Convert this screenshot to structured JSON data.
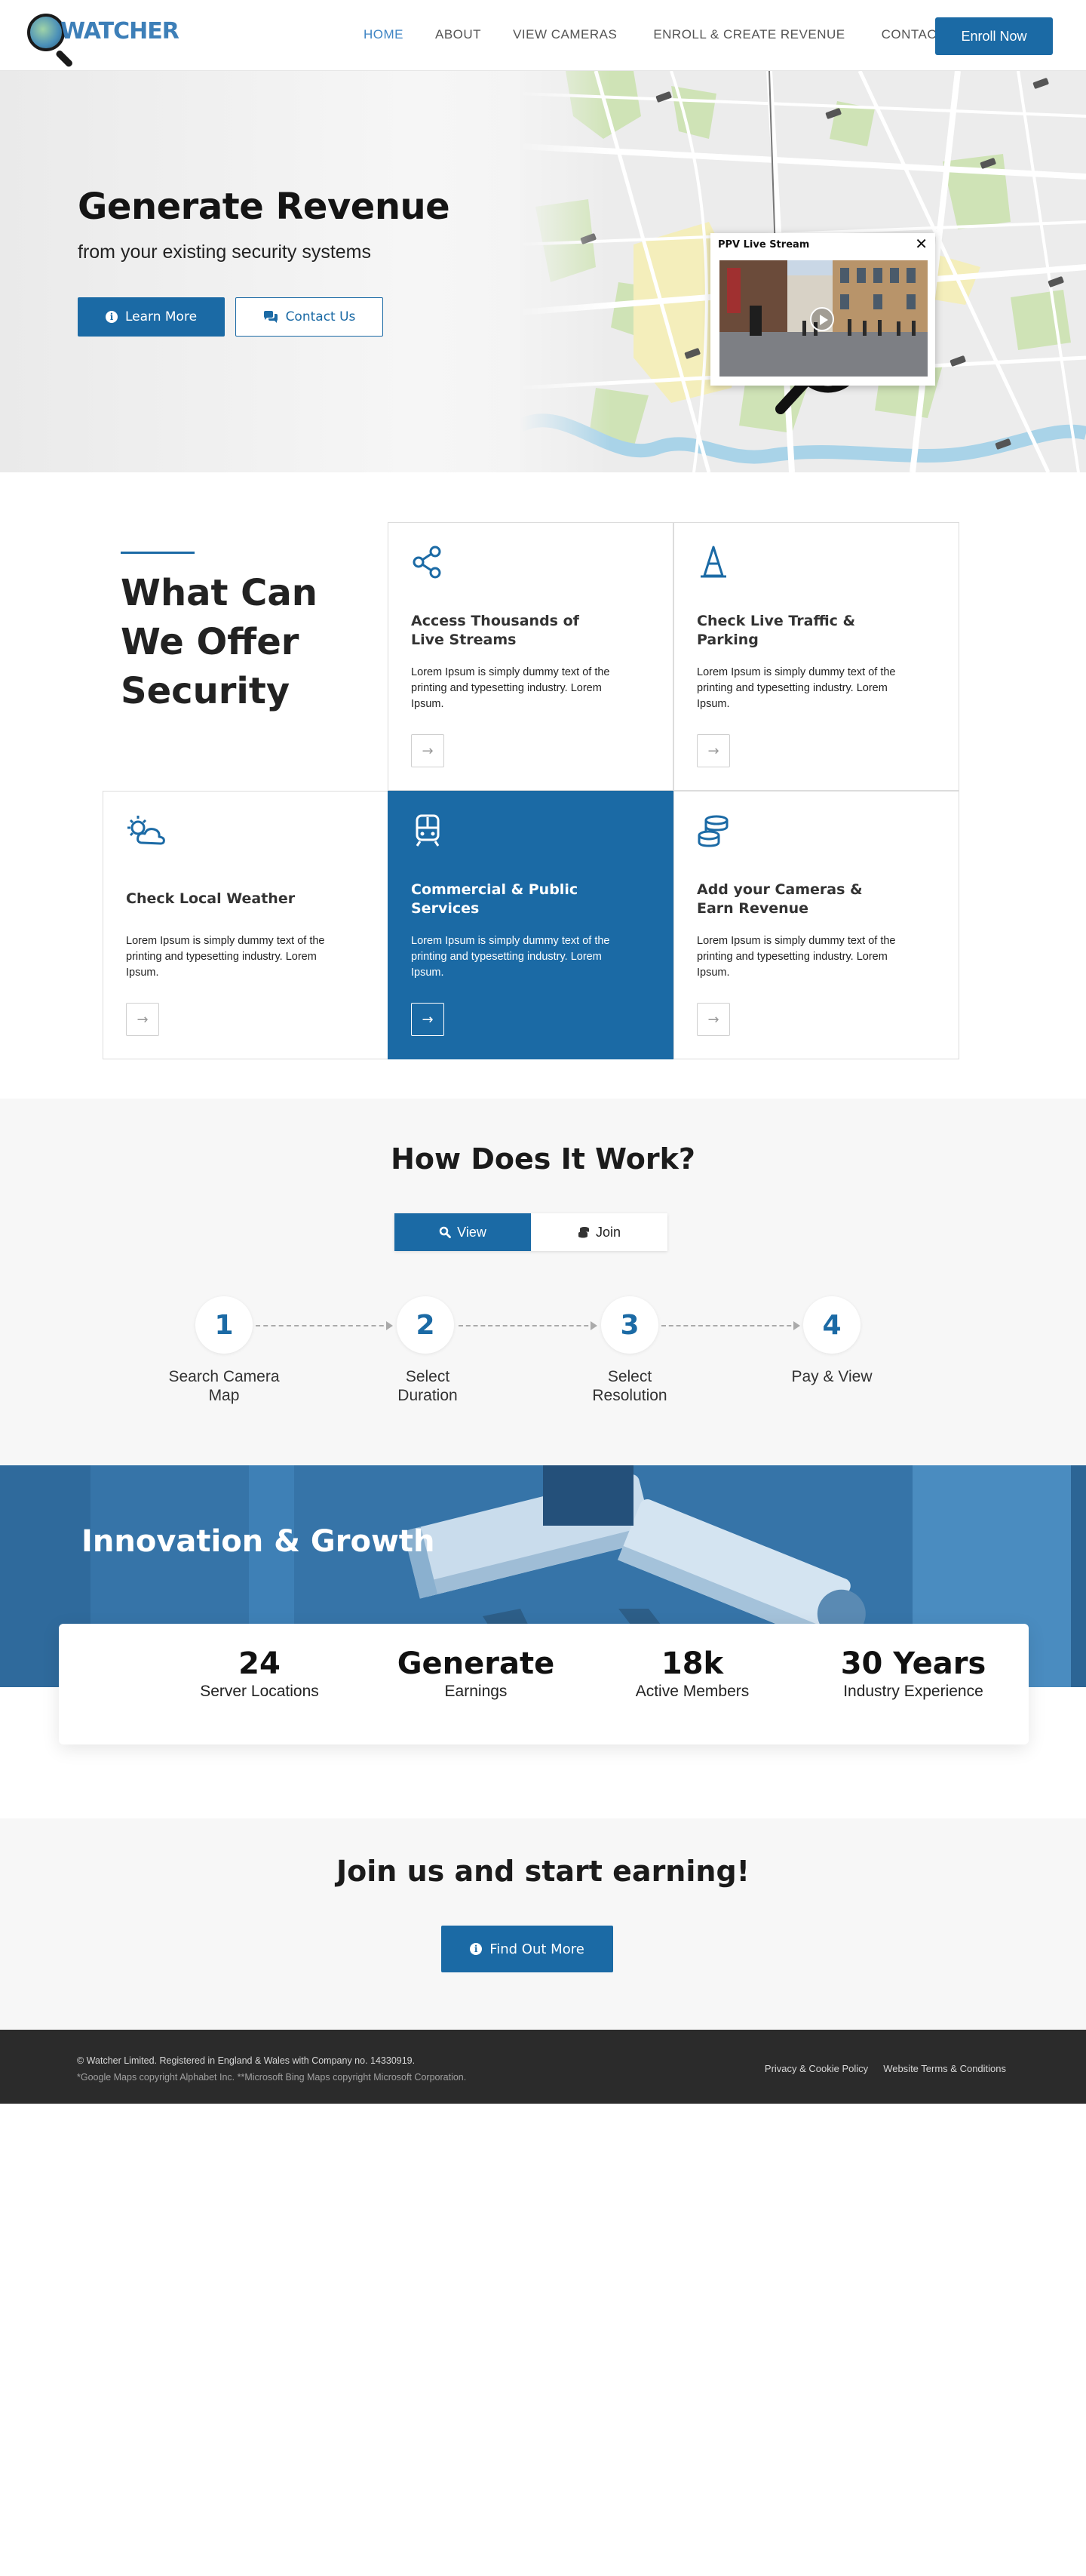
{
  "brand": {
    "name": "WATCHER",
    "color": "#1b6aa5"
  },
  "nav": {
    "items": [
      {
        "label": "HOME",
        "active": true
      },
      {
        "label": "ABOUT",
        "active": false
      },
      {
        "label": "VIEW CAMERAS",
        "active": false
      },
      {
        "label": "ENROLL & CREATE REVENUE",
        "active": false
      },
      {
        "label": "CONTACT",
        "active": false
      }
    ],
    "cta": "Enroll Now"
  },
  "hero": {
    "title": "Generate Revenue",
    "subtitle": "from your existing security systems",
    "learn_more": "Learn More",
    "contact_us": "Contact Us",
    "stream_card": {
      "title": "PPV Live Stream"
    }
  },
  "offer": {
    "heading_lines": [
      "What Can",
      "We Offer",
      "Security"
    ],
    "cards": [
      {
        "icon": "share-icon",
        "title_lines": [
          "Access Thousands of",
          "Live Streams"
        ],
        "text": "Lorem Ipsum is simply dummy text of the printing and typesetting industry. Lorem Ipsum.",
        "featured": false
      },
      {
        "icon": "traffic-cone-icon",
        "title_lines": [
          "Check Live Traffic &",
          "Parking"
        ],
        "text": "Lorem Ipsum is simply dummy text of the printing and typesetting industry. Lorem Ipsum.",
        "featured": false
      },
      {
        "icon": "weather-icon",
        "title_lines": [
          "Check Local Weather"
        ],
        "text": "Lorem Ipsum is simply dummy text of the printing and typesetting industry. Lorem Ipsum.",
        "featured": false
      },
      {
        "icon": "train-icon",
        "title_lines": [
          "Commercial & Public",
          "Services"
        ],
        "text": "Lorem Ipsum is simply dummy text of the printing and typesetting industry. Lorem Ipsum.",
        "featured": true
      },
      {
        "icon": "coins-icon",
        "title_lines": [
          "Add your Cameras &",
          "Earn Revenue"
        ],
        "text": "Lorem Ipsum is simply dummy text of the printing and typesetting industry. Lorem Ipsum.",
        "featured": false
      }
    ]
  },
  "how": {
    "title": "How Does It Work?",
    "tabs": [
      {
        "label": "View",
        "icon": "search-icon",
        "active": true
      },
      {
        "label": "Join",
        "icon": "coins-icon",
        "active": false
      }
    ],
    "steps": [
      {
        "number": "1",
        "label_lines": [
          "Search Camera",
          "Map"
        ]
      },
      {
        "number": "2",
        "label_lines": [
          "Select",
          "Duration"
        ]
      },
      {
        "number": "3",
        "label_lines": [
          "Select",
          "Resolution"
        ]
      },
      {
        "number": "4",
        "label_lines": [
          "Pay & View"
        ]
      }
    ]
  },
  "innovation": {
    "title": "Innovation & Growth",
    "stats": [
      {
        "value": "24",
        "label": "Server Locations"
      },
      {
        "value": "Generate",
        "label": "Earnings"
      },
      {
        "value": "18k",
        "label": "Active Members"
      },
      {
        "value": "30 Years",
        "label": "Industry Experience"
      }
    ]
  },
  "join": {
    "title": "Join us and start earning!",
    "button": "Find Out More"
  },
  "footer": {
    "copyright": "© Watcher Limited.  Registered in England & Wales with Company no. 14330919.",
    "note": "*Google Maps copyright Alphabet Inc.  **Microsoft Bing Maps copyright Microsoft Corporation.",
    "links": [
      "Privacy & Cookie Policy",
      "Website Terms & Conditions"
    ]
  }
}
